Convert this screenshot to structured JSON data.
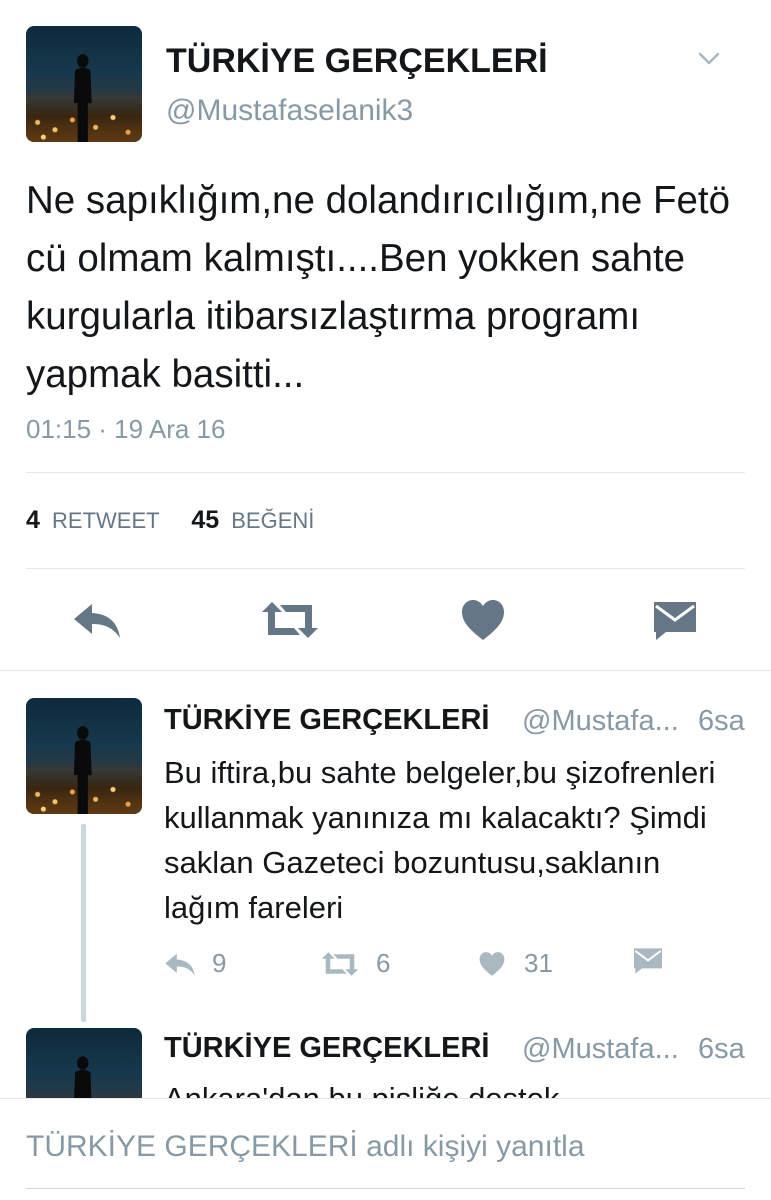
{
  "main_tweet": {
    "author_name": "TÜRKİYE GERÇEKLERİ",
    "handle": "@Mustafaselanik3",
    "text": "Ne sapıklığım,ne dolandırıcılığım,ne Fetö cü olmam kalmıştı....Ben yokken sahte kurgularla itibarsızlaştırma programı yapmak basitti...",
    "timestamp": "01:15 · 19 Ara 16",
    "retweet_count": "4",
    "retweet_label": "RETWEET",
    "like_count": "45",
    "like_label": "BEĞENİ",
    "menu_icon": "chevron-down-icon",
    "action_icons": [
      "reply-icon",
      "retweet-icon",
      "heart-icon",
      "envelope-icon"
    ]
  },
  "replies": [
    {
      "author_name": "TÜRKİYE GERÇEKLERİ",
      "handle": "@Mustafa...",
      "time": "6sa",
      "text": "Bu iftira,bu sahte belgeler,bu şizofrenleri kullanmak yanınıza mı kalacaktı? Şimdi saklan Gazeteci bozuntusu,saklanın lağım fareleri",
      "reply_count": "9",
      "retweet_count": "6",
      "like_count": "31"
    },
    {
      "author_name": "TÜRKİYE GERÇEKLERİ",
      "handle": "@Mustafa...",
      "time": "6sa",
      "text": "Ankara'dan bu pisliğe destek"
    }
  ],
  "reply_bar": {
    "placeholder": "TÜRKİYE GERÇEKLERİ adlı kişiyi yanıtla"
  },
  "colors": {
    "text": "#14171a",
    "muted": "#8899a6",
    "icon": "#657786",
    "divider": "#e1e8ed"
  }
}
